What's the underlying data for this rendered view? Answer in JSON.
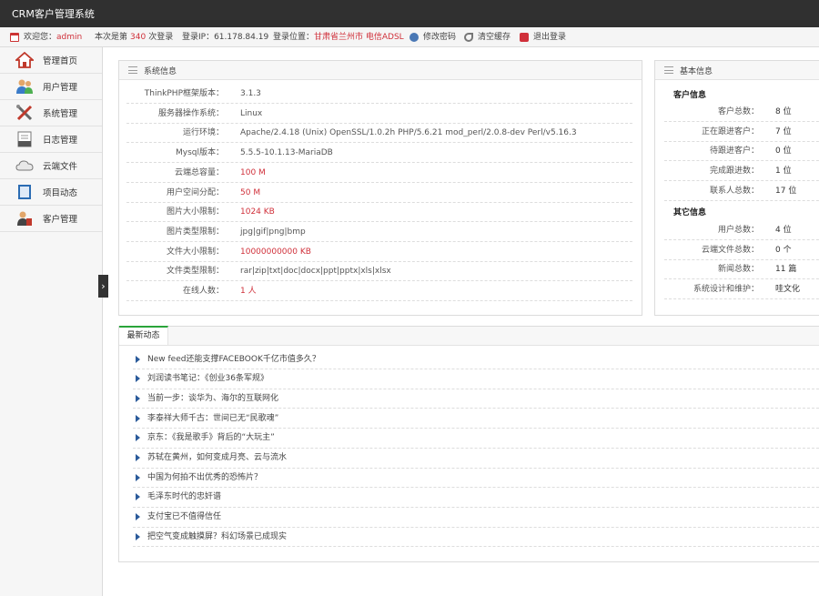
{
  "app_title": "CRM客户管理系统",
  "infobar": {
    "welcome_label": "欢迎您：",
    "user": "admin",
    "login_prefix": "本次是第",
    "login_count": "340",
    "login_suffix": "次登录",
    "ip": "登录IP：61.178.84.19",
    "location_label": "登录位置：",
    "location": "甘肃省兰州市 电信ADSL",
    "change_password": "修改密码",
    "clear_cache": "清空缓存",
    "logout": "退出登录"
  },
  "sidebar": {
    "items": [
      {
        "label": "管理首页"
      },
      {
        "label": "用户管理"
      },
      {
        "label": "系统管理"
      },
      {
        "label": "日志管理"
      },
      {
        "label": "云端文件"
      },
      {
        "label": "项目动态"
      },
      {
        "label": "客户管理"
      }
    ]
  },
  "sysinfo": {
    "title": "系统信息",
    "rows": [
      {
        "k": "ThinkPHP框架版本：",
        "v": "3.1.3",
        "red": false
      },
      {
        "k": "服务器操作系统：",
        "v": "Linux",
        "red": false
      },
      {
        "k": "运行环境：",
        "v": "Apache/2.4.18 (Unix) OpenSSL/1.0.2h PHP/5.6.21 mod_perl/2.0.8-dev Perl/v5.16.3",
        "red": false
      },
      {
        "k": "Mysql版本：",
        "v": "5.5.5-10.1.13-MariaDB",
        "red": false
      },
      {
        "k": "云端总容量：",
        "v": "100 M",
        "red": true
      },
      {
        "k": "用户空间分配：",
        "v": "50 M",
        "red": true
      },
      {
        "k": "图片大小限制：",
        "v": "1024 KB",
        "red": true
      },
      {
        "k": "图片类型限制：",
        "v": "jpg|gif|png|bmp",
        "red": false
      },
      {
        "k": "文件大小限制：",
        "v": "10000000000 KB",
        "red": true
      },
      {
        "k": "文件类型限制：",
        "v": "rar|zip|txt|doc|docx|ppt|pptx|xls|xlsx",
        "red": false
      },
      {
        "k": "在线人数：",
        "v": "1 人",
        "red": true
      }
    ]
  },
  "basic": {
    "title": "基本信息",
    "customer_heading": "客户信息",
    "customer_rows": [
      {
        "k": "客户总数：",
        "v": "8 位"
      },
      {
        "k": "正在跟进客户：",
        "v": "7 位"
      },
      {
        "k": "待跟进客户：",
        "v": "0 位"
      },
      {
        "k": "完成跟进数：",
        "v": "1 位"
      },
      {
        "k": "联系人总数：",
        "v": "17 位"
      }
    ],
    "other_heading": "其它信息",
    "other_rows": [
      {
        "k": "用户总数：",
        "v": "4 位"
      },
      {
        "k": "云端文件总数：",
        "v": "0 个"
      },
      {
        "k": "新闻总数：",
        "v": "11 篇"
      },
      {
        "k": "系统设计和维护：",
        "v": "哇文化"
      }
    ]
  },
  "news": {
    "tab": "最新动态",
    "items": [
      "New feed还能支撑FACEBOOK千亿市值多久？",
      "刘润读书笔记：《创业36条军规》",
      "当前一步：谈华为、海尔的互联网化",
      "李泰祥大师千古：世间已无“民歌魂”",
      "京东：《我是歌手》背后的“大玩主”",
      "苏轼在黄州，如何变成月亮、云与流水",
      "中国为何拍不出优秀的恐怖片？",
      "毛泽东时代的忠奸谱",
      "支付宝已不值得信任",
      "把空气变成触摸屏？科幻场景已成现实"
    ]
  },
  "colors": {
    "accent_red": "#d0303a",
    "tab_green": "#2aa43a",
    "titlebar": "#303030"
  }
}
